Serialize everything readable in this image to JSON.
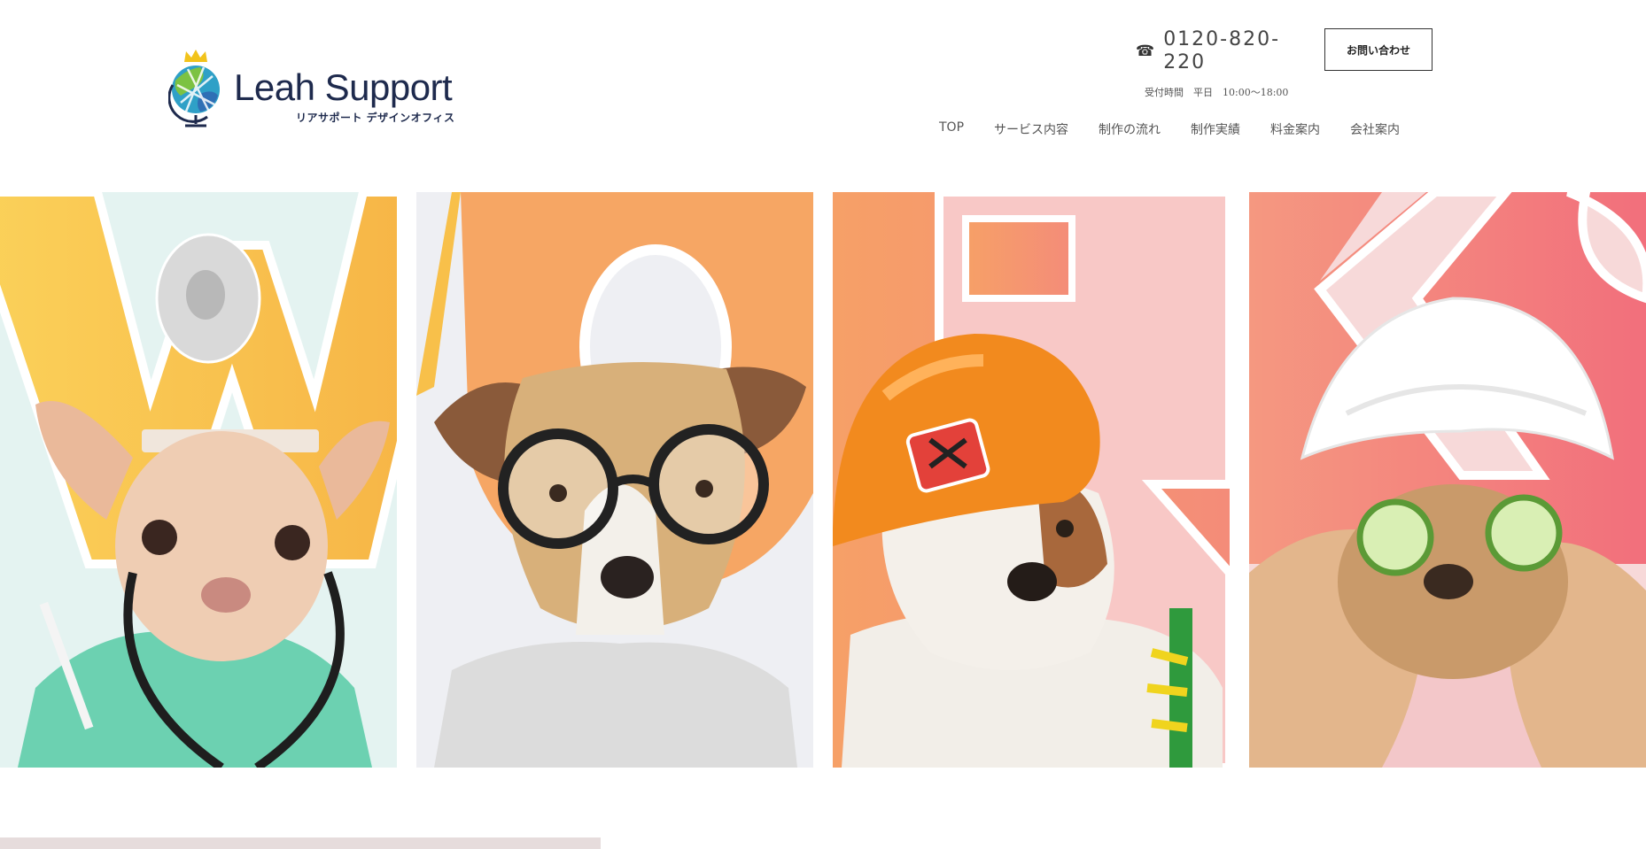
{
  "brand": {
    "name": "Leah Support",
    "subtitle": "リアサポート デザインオフィス",
    "logo_icon": "globe-crown-icon"
  },
  "contact": {
    "phone_icon": "phone-icon",
    "phone": "0120-820-220",
    "hours": "受付時間　平日　10:00〜18:00",
    "inquiry_label": "お問い合わせ"
  },
  "nav": {
    "items": [
      {
        "label": "TOP"
      },
      {
        "label": "サービス内容"
      },
      {
        "label": "制作の流れ"
      },
      {
        "label": "制作実績"
      },
      {
        "label": "料金案内"
      },
      {
        "label": "会社案内"
      }
    ]
  },
  "hero": {
    "letters": [
      "W",
      "O",
      "R",
      "K",
      "S"
    ],
    "panels": [
      {
        "subject": "dog-doctor",
        "bg": "#e4f3f1",
        "letter_color": "#f8c04a"
      },
      {
        "subject": "dog-glasses",
        "bg": "#eeeff3",
        "letter_color": "#f6a664"
      },
      {
        "subject": "dog-hardhat",
        "bg": "#f9cfd0",
        "letter_color": "#f4a07a"
      },
      {
        "subject": "dog-spa-towel",
        "bg": "#f7d9d9",
        "letter_color": "#f27e84"
      }
    ]
  }
}
